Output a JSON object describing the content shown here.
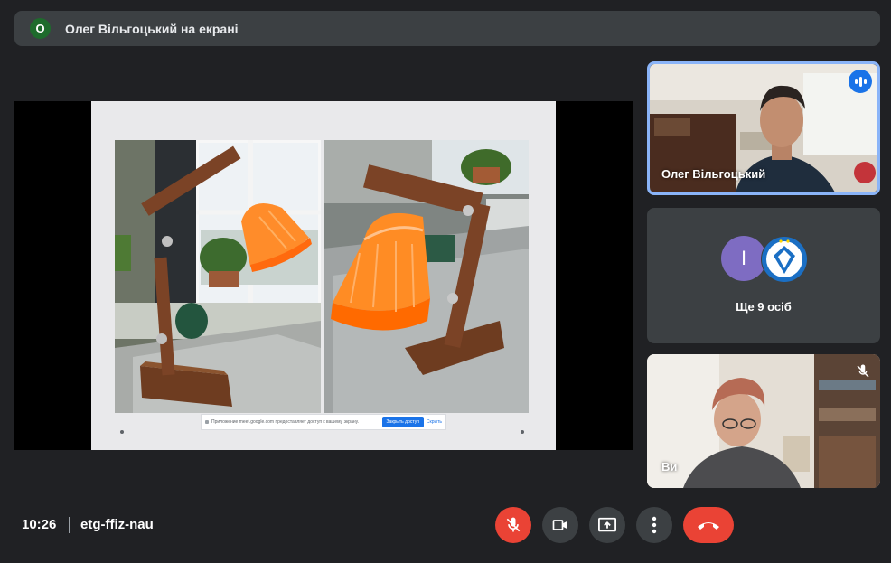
{
  "presenter_bar": {
    "avatar_letter": "О",
    "title": "Олег Вільгоцький на екрані"
  },
  "slide": {
    "share_message": "Приложение meet.google.com предоставляет доступ к вашему экрану.",
    "stop_label": "Закрыть доступ",
    "hide_label": "Скрыть"
  },
  "tiles": {
    "active_speaker_name": "Олег Вільгоцький",
    "others_avatar_letter": "І",
    "others_count_label": "Ще 9 осіб",
    "self_label": "Ви"
  },
  "bottom": {
    "time": "10:26",
    "meeting_code": "etg-ffiz-nau"
  },
  "colors": {
    "background": "#202124",
    "surface": "#3c4043",
    "accent_blue": "#1a73e8",
    "active_outline": "#8ab4f8",
    "danger_red": "#ea4335",
    "presenter_avatar": "#1e6b2c",
    "avatar_purple": "#7e6cc2"
  },
  "icons": {
    "mic": "mic-off-icon",
    "camera": "videocam-icon",
    "present": "present-to-all-icon",
    "more": "more-vert-icon",
    "hangup": "call-end-icon",
    "speaking": "speaking-indicator-icon",
    "muted": "mic-off-icon"
  }
}
